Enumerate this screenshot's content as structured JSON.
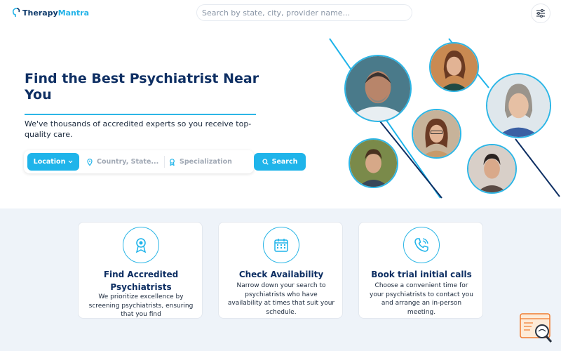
{
  "brand": {
    "name_part1": "Therapy",
    "name_part2": "Mantra"
  },
  "header": {
    "search_placeholder": "Search by state, city, provider name..."
  },
  "hero": {
    "title": "Find the Best Psychiatrist Near You",
    "subtitle": "We've thousands of accredited experts so you receive top-quality care."
  },
  "search_panel": {
    "location_label": "Location",
    "country_placeholder": "Country, State...",
    "specialization_placeholder": "Specialization",
    "search_label": "Search"
  },
  "features": [
    {
      "title": "Find Accredited Psychiatrists",
      "description": "We prioritize excellence by screening psychiatrists, ensuring that you find",
      "icon": "award-icon"
    },
    {
      "title": "Check Availability",
      "description": "Narrow down your search to psychiatrists who have availability at times that suit your schedule.",
      "icon": "calendar-icon"
    },
    {
      "title": "Book trial initial calls",
      "description": "Choose a convenient time for your psychiatrists to contact you and arrange an in-person meeting.",
      "icon": "phone-icon"
    }
  ],
  "colors": {
    "accent": "#1fb4ea",
    "navy": "#0e2f63",
    "section_bg": "#eef3f9"
  }
}
